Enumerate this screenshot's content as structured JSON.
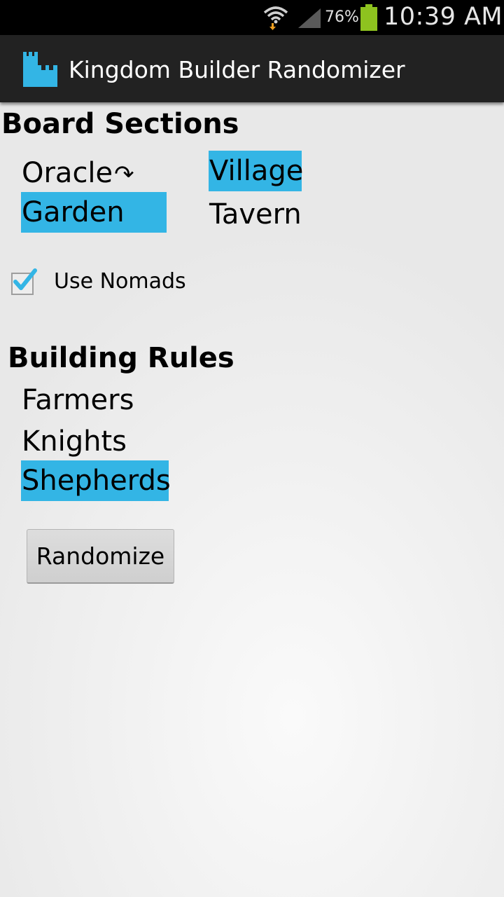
{
  "status_bar": {
    "battery_percent": "76%",
    "time": "10:39 AM",
    "icons": [
      "wifi-download-icon",
      "cell-signal-icon",
      "battery-charging-icon"
    ],
    "battery_color": "#8ec31f"
  },
  "action_bar": {
    "title": "Kingdom Builder Randomizer",
    "icon": "castle-icon",
    "icon_color": "#33b5e5"
  },
  "board_sections": {
    "heading": "Board Sections",
    "items": [
      {
        "label": "Oracle",
        "selected": false,
        "flipped": true,
        "flip_glyph": "↷"
      },
      {
        "label": "Village",
        "selected": true
      },
      {
        "label": "Garden",
        "selected": true
      },
      {
        "label": "Tavern",
        "selected": false
      }
    ]
  },
  "nomads": {
    "label": "Use Nomads",
    "checked": true
  },
  "building_rules": {
    "heading": "Building Rules",
    "items": [
      {
        "label": "Farmers",
        "selected": false
      },
      {
        "label": "Knights",
        "selected": false
      },
      {
        "label": "Shepherds",
        "selected": true
      }
    ]
  },
  "randomize_button": {
    "label": "Randomize"
  },
  "colors": {
    "selection_highlight": "#33b5e5",
    "action_bar_bg": "#222222",
    "status_bar_bg": "#000000"
  }
}
